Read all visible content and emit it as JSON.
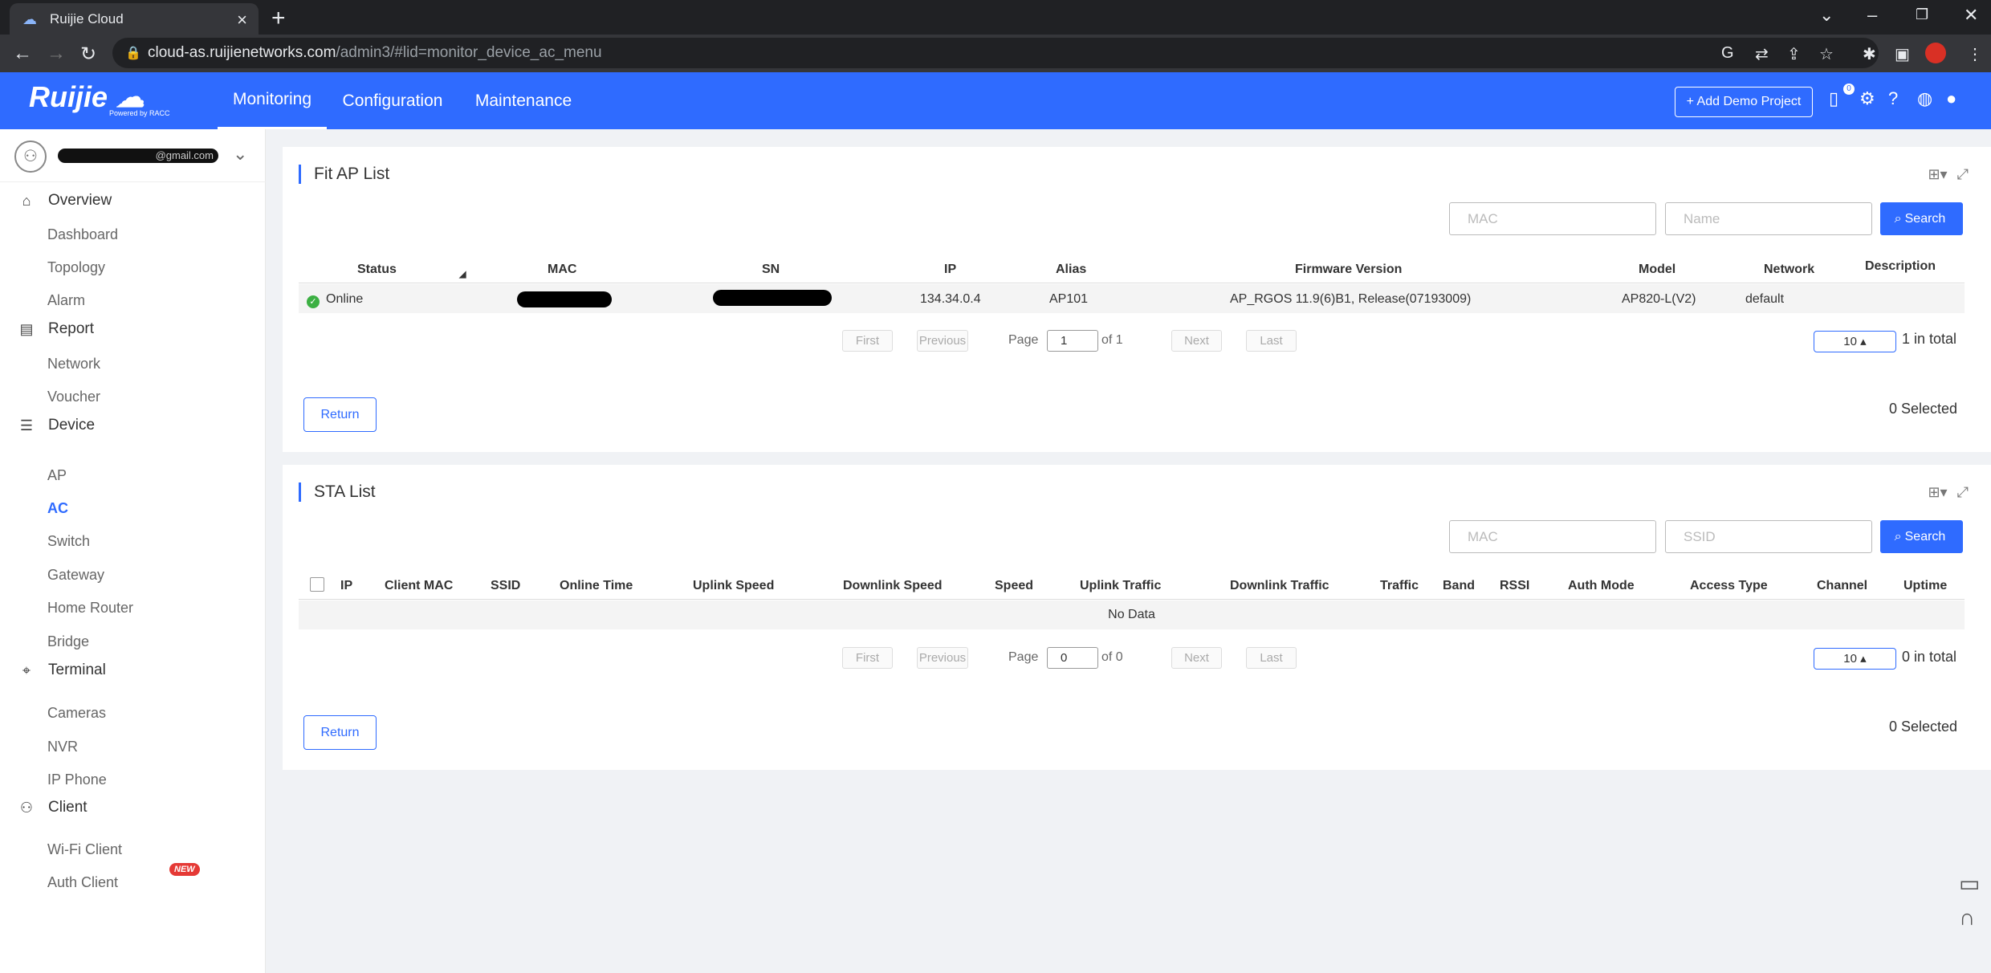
{
  "browser": {
    "tab_title": "Ruijie Cloud",
    "url_domain": "cloud-as.ruijienetworks.com",
    "url_path": "/admin3/#lid=monitor_device_ac_menu"
  },
  "header": {
    "logo": "Ruijie",
    "logo_sub": "Powered by RACC",
    "nav": [
      "Monitoring",
      "Configuration",
      "Maintenance"
    ],
    "add_demo_label": "+ Add Demo Project",
    "notif_count": "0"
  },
  "sidebar": {
    "account_suffix": "@gmail.com",
    "sections": [
      {
        "label": "Overview",
        "icon": "home-icon",
        "items": [
          "Dashboard",
          "Topology",
          "Alarm"
        ]
      },
      {
        "label": "Report",
        "icon": "report-icon",
        "items": [
          "Network",
          "Voucher"
        ]
      },
      {
        "label": "Device",
        "icon": "device-icon",
        "items": [
          "AP",
          "AC",
          "Switch",
          "Gateway",
          "Home Router",
          "Bridge"
        ]
      },
      {
        "label": "Terminal",
        "icon": "terminal-icon",
        "items": [
          "Cameras",
          "NVR",
          "IP Phone"
        ]
      },
      {
        "label": "Client",
        "icon": "client-icon",
        "items": [
          "Wi-Fi Client",
          "Auth Client"
        ]
      }
    ],
    "active_item": "AC",
    "new_badge": "NEW"
  },
  "fit_ap": {
    "title": "Fit AP List",
    "mac_placeholder": "MAC",
    "name_placeholder": "Name",
    "search_label": "Search",
    "columns": [
      "Status",
      "MAC",
      "SN",
      "IP",
      "Alias",
      "Firmware Version",
      "Model",
      "Network",
      "Description"
    ],
    "rows": [
      {
        "status": "Online",
        "ip": "134.34.0.4",
        "alias": "AP101",
        "firmware": "AP_RGOS 11.9(6)B1, Release(07193009)",
        "model": "AP820-L(V2)",
        "network": "default",
        "description": ""
      }
    ],
    "pager": {
      "first": "First",
      "previous": "Previous",
      "page_label": "Page",
      "page": "1",
      "of": "of 1",
      "next": "Next",
      "last": "Last",
      "size": "10 ▴",
      "total": "1 in total"
    },
    "return_label": "Return",
    "selected": "0 Selected"
  },
  "sta": {
    "title": "STA List",
    "mac_placeholder": "MAC",
    "ssid_placeholder": "SSID",
    "search_label": "Search",
    "columns": [
      "IP",
      "Client MAC",
      "SSID",
      "Online Time",
      "Uplink Speed",
      "Downlink Speed",
      "Speed",
      "Uplink Traffic",
      "Downlink Traffic",
      "Traffic",
      "Band",
      "RSSI",
      "Auth Mode",
      "Access Type",
      "Channel",
      "Uptime"
    ],
    "no_data": "No Data",
    "pager": {
      "first": "First",
      "previous": "Previous",
      "page_label": "Page",
      "page": "0",
      "of": "of 0",
      "next": "Next",
      "last": "Last",
      "size": "10 ▴",
      "total": "0 in total"
    },
    "return_label": "Return",
    "selected": "0 Selected"
  },
  "colors": {
    "brand": "#2f6bff",
    "online": "#3cb043",
    "badge": "#e53935"
  }
}
